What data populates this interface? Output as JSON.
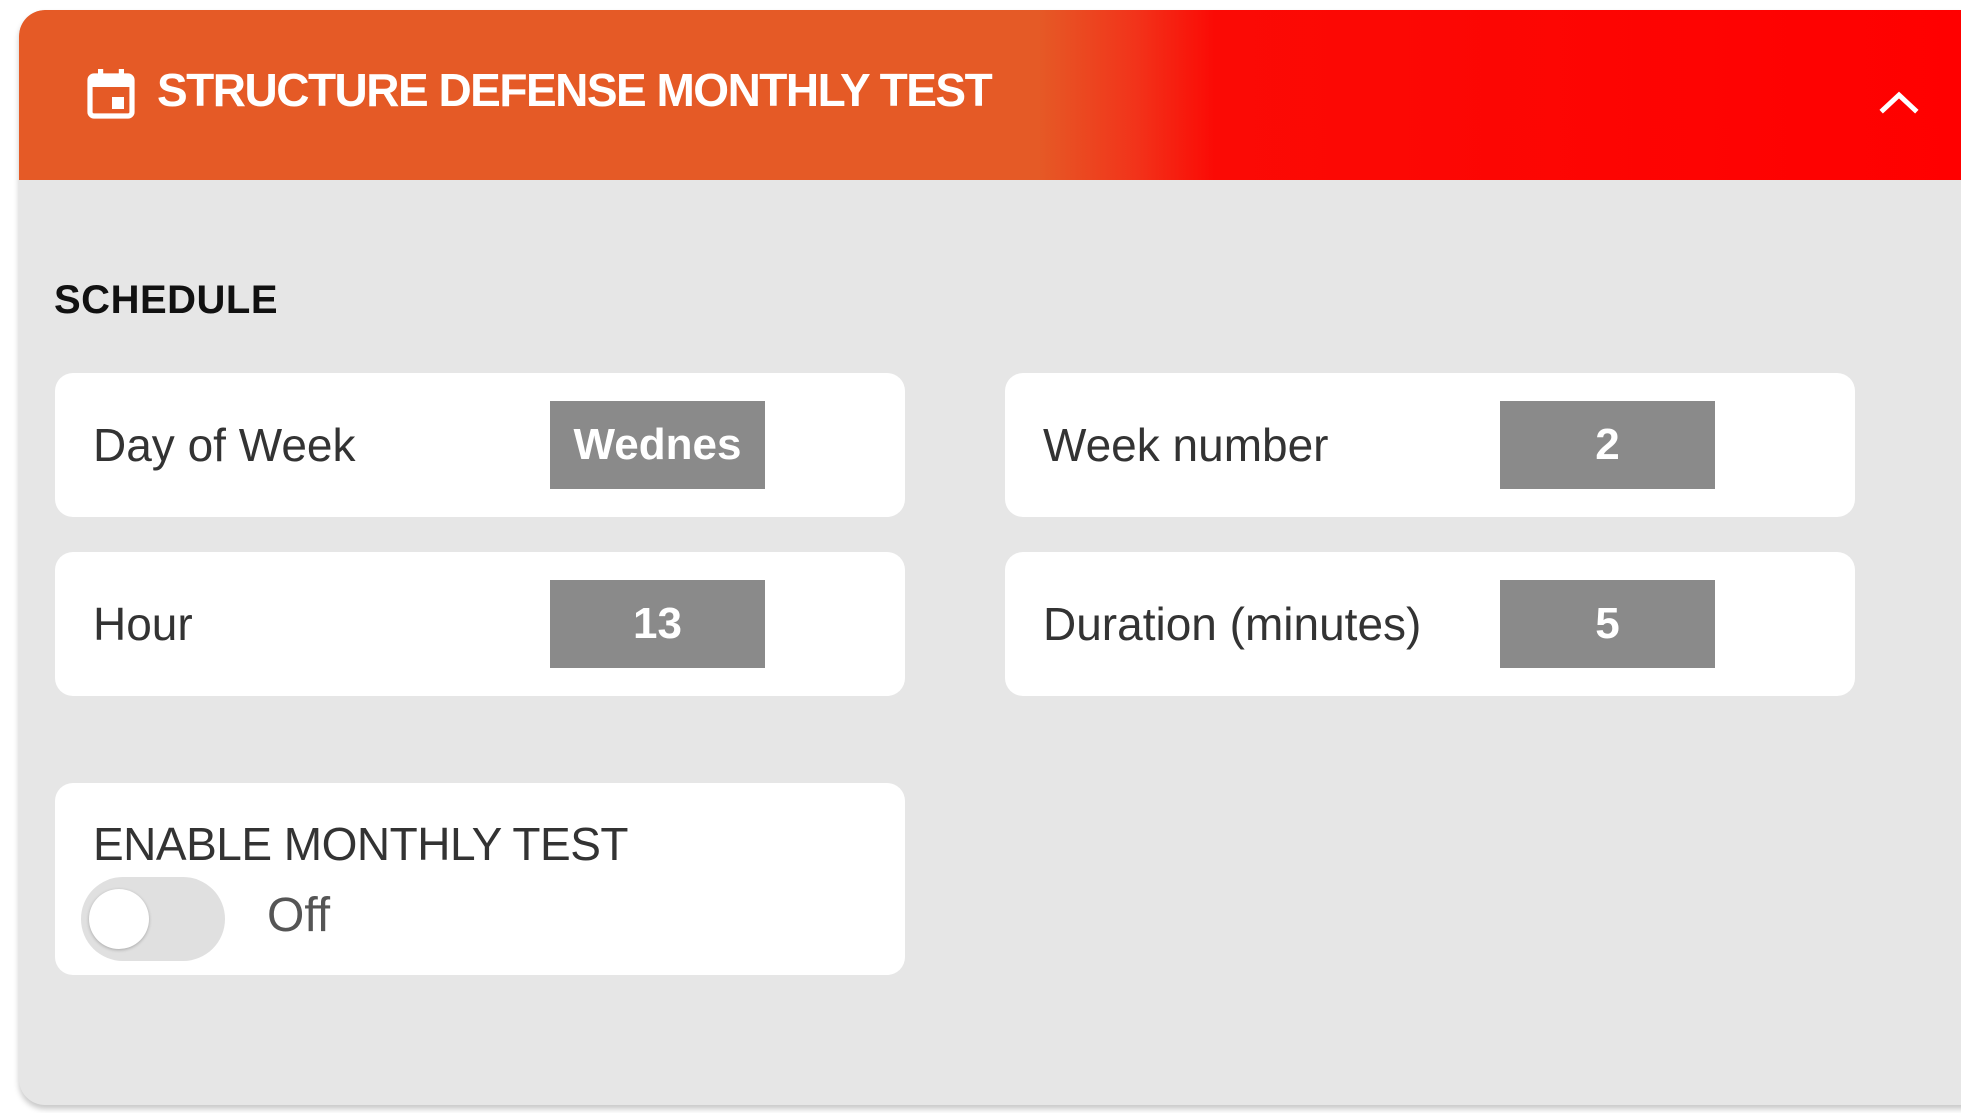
{
  "header": {
    "title": "STRUCTURE DEFENSE MONTHLY TEST",
    "icon": "calendar-icon",
    "collapse_icon": "chevron-up-icon",
    "gradient_colors": [
      "#e55a26",
      "#ff0000"
    ]
  },
  "schedule": {
    "section_label": "SCHEDULE",
    "fields": [
      {
        "label": "Day of Week",
        "value": "Wednes"
      },
      {
        "label": "Week number",
        "value": "2"
      },
      {
        "label": "Hour",
        "value": "13"
      },
      {
        "label": "Duration (minutes)",
        "value": "5"
      }
    ]
  },
  "enable": {
    "label": "ENABLE MONTHLY TEST",
    "state_label": "Off",
    "enabled": false
  },
  "colors": {
    "card_background": "#e6e6e6",
    "value_background": "#8a8a8a",
    "text": "#333333"
  }
}
